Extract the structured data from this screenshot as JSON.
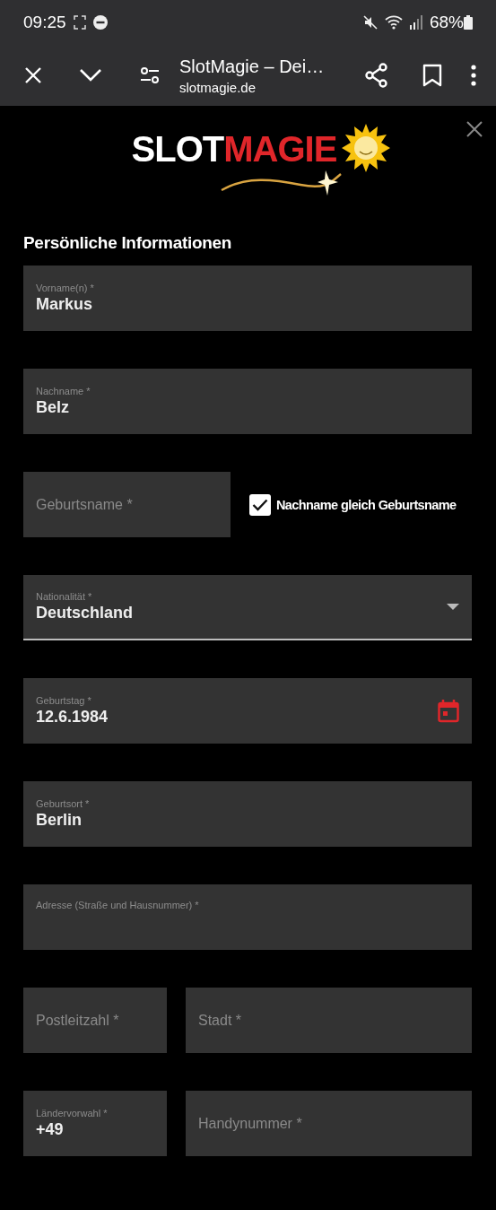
{
  "status_bar": {
    "time": "09:25",
    "battery": "68%"
  },
  "browser_bar": {
    "title": "SlotMagie – Dei…",
    "url": "slotmagie.de"
  },
  "logo": {
    "prefix": "SLOT",
    "suffix": "MAGIE"
  },
  "section_title": "Persönliche Informationen",
  "rows": [
    {
      "kind": "single",
      "fields": [
        {
          "kind": "text",
          "label": "Vorname(n) *",
          "value": "Markus"
        }
      ]
    },
    {
      "kind": "single",
      "fields": [
        {
          "kind": "text",
          "label": "Nachname *",
          "value": "Belz"
        }
      ]
    },
    {
      "kind": "check",
      "fields": [
        {
          "kind": "text",
          "placeholder": "Geburtsname *"
        }
      ],
      "checkbox": {
        "label": "Nachname gleich Geburtsname",
        "checked": true
      }
    },
    {
      "kind": "single",
      "fields": [
        {
          "kind": "select",
          "label": "Nationalität *",
          "value": "Deutschland"
        }
      ]
    },
    {
      "kind": "single",
      "fields": [
        {
          "kind": "date",
          "label": "Geburtstag *",
          "value": "12.6.1984"
        }
      ]
    },
    {
      "kind": "single",
      "fields": [
        {
          "kind": "text",
          "label": "Geburtsort *",
          "value": "Berlin"
        }
      ]
    },
    {
      "kind": "single",
      "fields": [
        {
          "kind": "text",
          "label": "Adresse (Straße und Hausnummer) *"
        }
      ]
    },
    {
      "kind": "split",
      "fields": [
        {
          "kind": "text",
          "placeholder": "Postleitzahl *"
        },
        {
          "kind": "text",
          "placeholder": "Stadt *"
        }
      ]
    },
    {
      "kind": "split",
      "fields": [
        {
          "kind": "text",
          "label": "Ländervorwahl *",
          "value": "+49"
        },
        {
          "kind": "text",
          "placeholder": "Handynummer *"
        }
      ]
    }
  ]
}
